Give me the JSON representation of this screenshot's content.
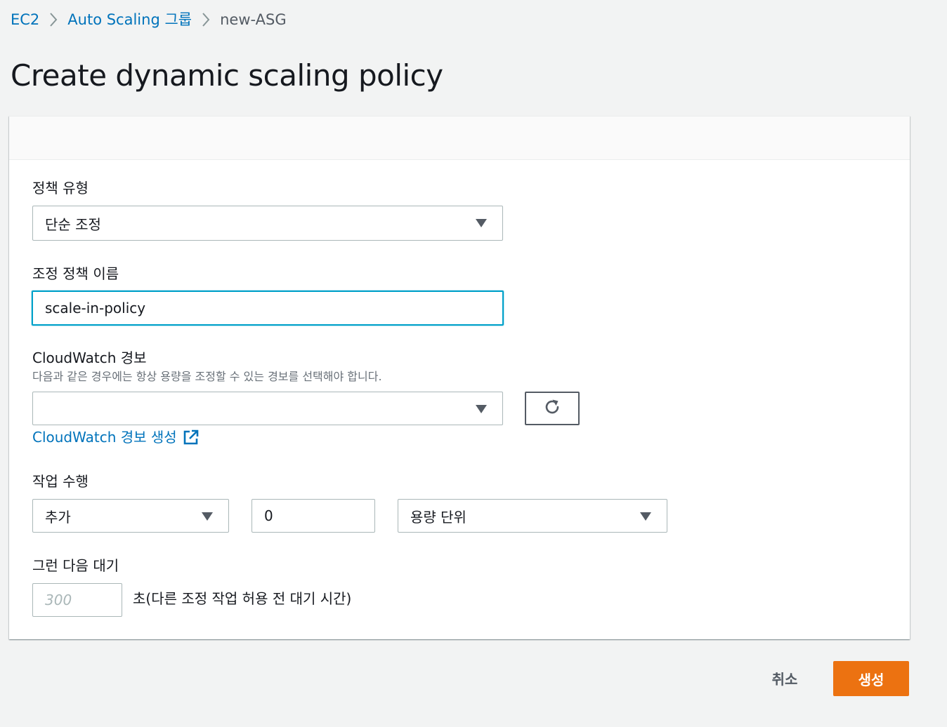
{
  "breadcrumb": {
    "items": [
      {
        "label": "EC2"
      },
      {
        "label": "Auto Scaling 그룹"
      },
      {
        "label": "new-ASG"
      }
    ]
  },
  "page": {
    "title": "Create dynamic scaling policy"
  },
  "form": {
    "policy_type": {
      "label": "정책 유형",
      "selected": "단순 조정"
    },
    "policy_name": {
      "label": "조정 정책 이름",
      "value": "scale-in-policy"
    },
    "cloudwatch_alarm": {
      "label": "CloudWatch 경보",
      "description": "다음과 같은 경우에는 항상 용량을 조정할 수 있는 경보를 선택해야 합니다.",
      "selected": "",
      "create_link": "CloudWatch 경보 생성"
    },
    "take_action": {
      "label": "작업 수행",
      "action_selected": "추가",
      "amount_value": "0",
      "unit_selected": "용량 단위"
    },
    "then_wait": {
      "label": "그런 다음 대기",
      "placeholder": "300",
      "suffix": "초(다른 조정 작업 허용 전 대기 시간)"
    }
  },
  "footer": {
    "cancel_label": "취소",
    "create_label": "생성"
  },
  "colors": {
    "link": "#0073bb",
    "primary_button": "#ec7211",
    "focus_border": "#00a1c9",
    "background": "#f2f3f3"
  },
  "icons": [
    "chevron-right-icon",
    "caret-down-icon",
    "refresh-icon",
    "external-link-icon"
  ]
}
